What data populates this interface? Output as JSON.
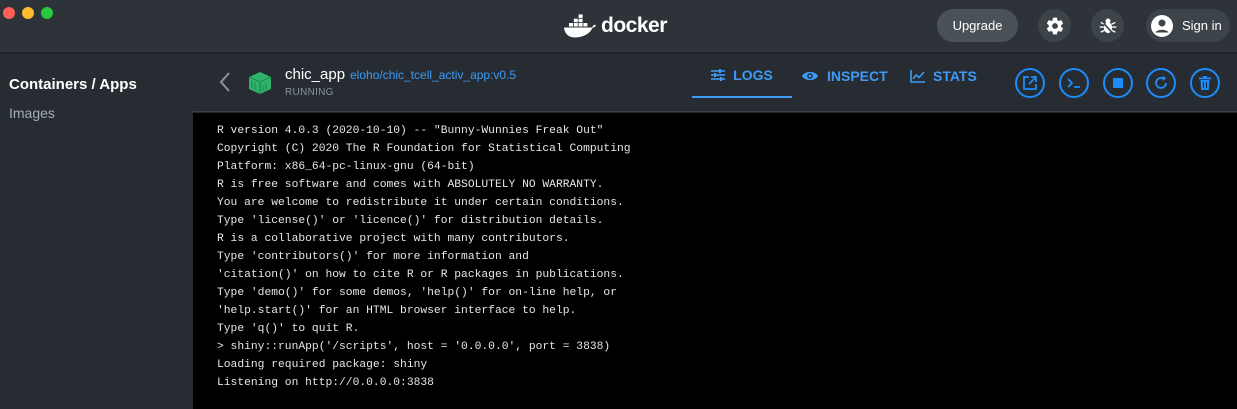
{
  "window": {
    "title": "docker"
  },
  "topbar": {
    "logo_text": "docker",
    "upgrade_label": "Upgrade",
    "signin_label": "Sign in"
  },
  "sidebar": {
    "items": [
      {
        "label": "Containers / Apps",
        "active": true
      },
      {
        "label": "Images",
        "active": false
      }
    ]
  },
  "container": {
    "name": "chic_app",
    "image": "eloho/chic_tcell_activ_app:v0.5",
    "status": "RUNNING"
  },
  "tabs": [
    {
      "label": "LOGS",
      "icon": "logs-icon",
      "active": true
    },
    {
      "label": "INSPECT",
      "icon": "eye-icon",
      "active": false
    },
    {
      "label": "STATS",
      "icon": "chart-icon",
      "active": false
    }
  ],
  "actions": [
    "open-in-browser-icon",
    "cli-icon",
    "stop-icon",
    "restart-icon",
    "delete-icon"
  ],
  "colors": {
    "accent": "#3d9bf5",
    "logs_bg": "#000000",
    "container_icon": "#2eb36b"
  },
  "logs": [
    "R version 4.0.3 (2020-10-10) -- \"Bunny-Wunnies Freak Out\"",
    "Copyright (C) 2020 The R Foundation for Statistical Computing",
    "Platform: x86_64-pc-linux-gnu (64-bit)",
    "R is free software and comes with ABSOLUTELY NO WARRANTY.",
    "You are welcome to redistribute it under certain conditions.",
    "Type 'license()' or 'licence()' for distribution details.",
    "R is a collaborative project with many contributors.",
    "Type 'contributors()' for more information and",
    "'citation()' on how to cite R or R packages in publications.",
    "Type 'demo()' for some demos, 'help()' for on-line help, or",
    "'help.start()' for an HTML browser interface to help.",
    "Type 'q()' to quit R.",
    "> shiny::runApp('/scripts', host = '0.0.0.0', port = 3838)",
    "Loading required package: shiny",
    "Listening on http://0.0.0.0:3838"
  ]
}
